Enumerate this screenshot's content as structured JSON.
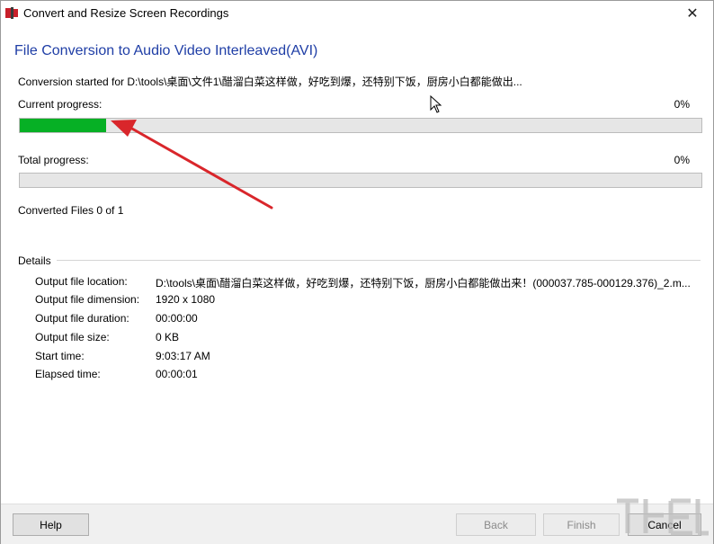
{
  "window": {
    "title": "Convert and Resize Screen Recordings"
  },
  "heading": "File Conversion to Audio Video Interleaved(AVI)",
  "status_line": "Conversion started for D:\\tools\\桌面\\文件1\\醋溜白菜这样做，好吃到爆，还特别下饭，厨房小白都能做出...",
  "progress": {
    "current": {
      "label": "Current progress:",
      "percent_text": "0%",
      "fill_fraction": 0.127
    },
    "total": {
      "label": "Total progress:",
      "percent_text": "0%",
      "fill_fraction": 0.0
    }
  },
  "converted_files": "Converted Files 0 of 1",
  "details": {
    "title": "Details",
    "rows": [
      {
        "label": "Output file location:",
        "value": "D:\\tools\\桌面\\醋溜白菜这样做，好吃到爆，还特别下饭，厨房小白都能做出来！(000037.785-000129.376)_2.m..."
      },
      {
        "label": "Output file dimension:",
        "value": "1920 x 1080"
      },
      {
        "label": "Output file duration:",
        "value": "00:00:00"
      },
      {
        "label": "Output file size:",
        "value": "0 KB"
      },
      {
        "label": "Start time:",
        "value": "9:03:17 AM"
      },
      {
        "label": "Elapsed time:",
        "value": "00:00:01"
      }
    ]
  },
  "buttons": {
    "help": "Help",
    "back": "Back",
    "finish": "Finish",
    "cancel": "Cancel"
  },
  "colors": {
    "heading": "#1f3ea6",
    "progress_fill": "#06b025",
    "annotation_arrow": "#d9262b"
  },
  "icons": {
    "app": "app-logo-icon",
    "close": "close-icon",
    "cursor": "mouse-pointer-icon"
  }
}
